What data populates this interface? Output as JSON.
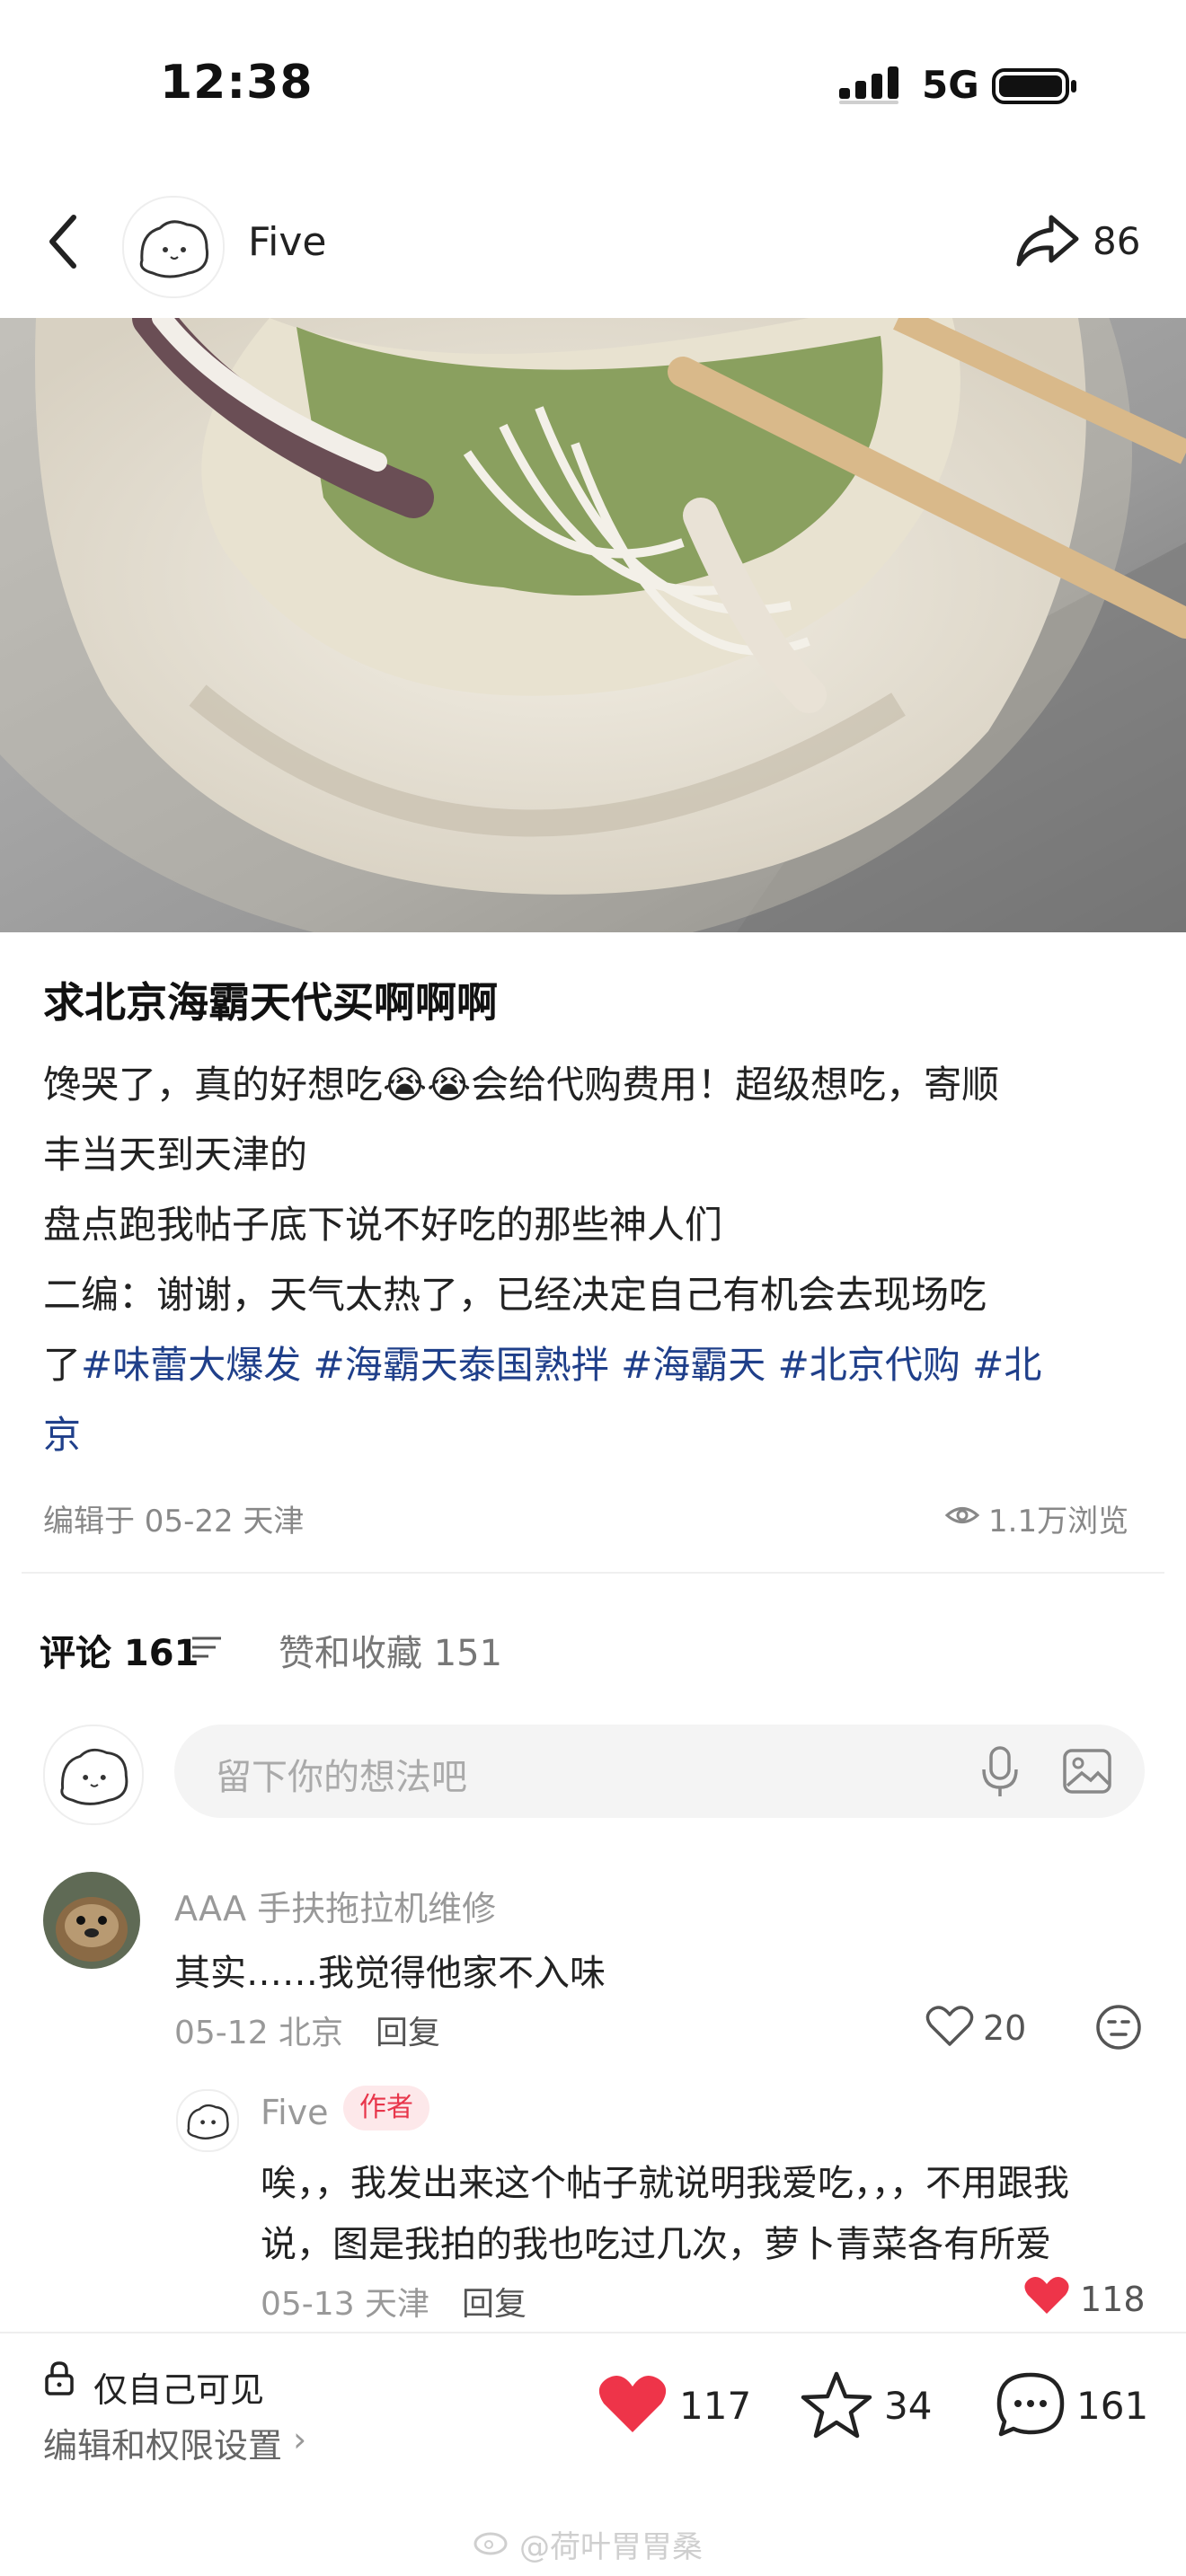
{
  "status_bar": {
    "time": "12:38",
    "network": "5G"
  },
  "header": {
    "author": "Five",
    "share_count": "86"
  },
  "post": {
    "title": "求北京海霸天代买啊啊啊",
    "lines": [
      "馋哭了，真的好想吃😭😭会给代购费用！超级想吃，寄顺",
      "丰当天到天津的",
      "盘点跑我帖子底下说不好吃的那些神人们",
      "二编：谢谢，天气太热了，已经决定自己有机会去现场吃"
    ],
    "line5_prefix": "了",
    "tags_line5": "#味蕾大爆发 #海霸天泰国熟拌 #海霸天 #北京代购 #北",
    "tags_line6": "京",
    "meta_date": "编辑于 05-22 天津",
    "meta_views": "1.1万浏览"
  },
  "tabs": {
    "comments": "评论 161",
    "likes": "赞和收藏 151"
  },
  "comment_input": {
    "placeholder": "留下你的想法吧"
  },
  "comments": [
    {
      "user": "AAA 手扶拖拉机维修",
      "text": "其实……我觉得他家不入味",
      "meta": "05-12 北京",
      "reply_label": "回复",
      "likes": "20",
      "replies": [
        {
          "user": "Five",
          "badge": "作者",
          "lines": [
            "唉，，我发出来这个帖子就说明我爱吃，，，不用跟我",
            "说，图是我拍的我也吃过几次，萝卜青菜各有所爱"
          ],
          "meta": "05-13 天津",
          "reply_label": "回复",
          "likes": "118"
        }
      ]
    }
  ],
  "bottom_bar": {
    "visibility": "仅自己可见",
    "permission": "编辑和权限设置",
    "likes": "117",
    "stars": "34",
    "comments": "161"
  },
  "watermark": "@荷叶胃胃桑",
  "colors": {
    "accent_red": "#ee3449",
    "tag_blue": "#1f3f8a"
  }
}
